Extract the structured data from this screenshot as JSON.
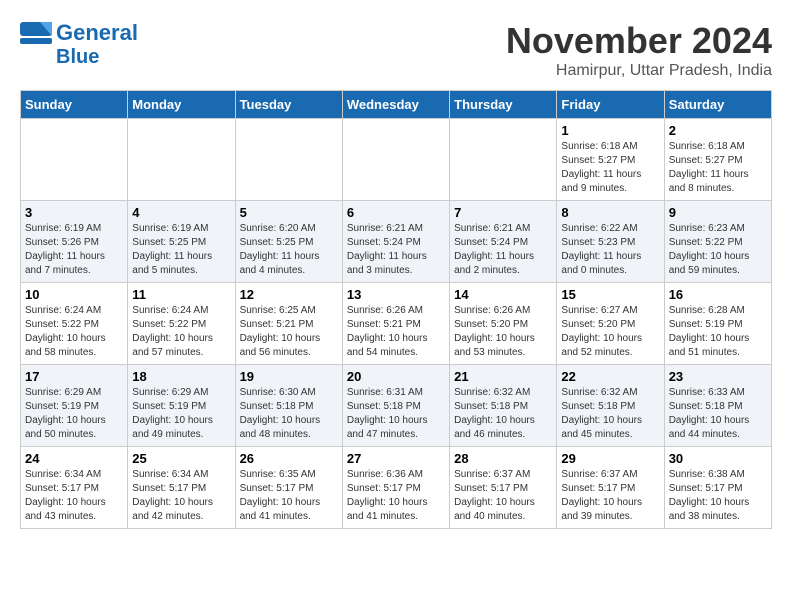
{
  "logo": {
    "line1": "General",
    "line2": "Blue"
  },
  "title": "November 2024",
  "location": "Hamirpur, Uttar Pradesh, India",
  "weekdays": [
    "Sunday",
    "Monday",
    "Tuesday",
    "Wednesday",
    "Thursday",
    "Friday",
    "Saturday"
  ],
  "weeks": [
    [
      {
        "day": "",
        "sunrise": "",
        "sunset": "",
        "daylight": ""
      },
      {
        "day": "",
        "sunrise": "",
        "sunset": "",
        "daylight": ""
      },
      {
        "day": "",
        "sunrise": "",
        "sunset": "",
        "daylight": ""
      },
      {
        "day": "",
        "sunrise": "",
        "sunset": "",
        "daylight": ""
      },
      {
        "day": "",
        "sunrise": "",
        "sunset": "",
        "daylight": ""
      },
      {
        "day": "1",
        "sunrise": "Sunrise: 6:18 AM",
        "sunset": "Sunset: 5:27 PM",
        "daylight": "Daylight: 11 hours and 9 minutes."
      },
      {
        "day": "2",
        "sunrise": "Sunrise: 6:18 AM",
        "sunset": "Sunset: 5:27 PM",
        "daylight": "Daylight: 11 hours and 8 minutes."
      }
    ],
    [
      {
        "day": "3",
        "sunrise": "Sunrise: 6:19 AM",
        "sunset": "Sunset: 5:26 PM",
        "daylight": "Daylight: 11 hours and 7 minutes."
      },
      {
        "day": "4",
        "sunrise": "Sunrise: 6:19 AM",
        "sunset": "Sunset: 5:25 PM",
        "daylight": "Daylight: 11 hours and 5 minutes."
      },
      {
        "day": "5",
        "sunrise": "Sunrise: 6:20 AM",
        "sunset": "Sunset: 5:25 PM",
        "daylight": "Daylight: 11 hours and 4 minutes."
      },
      {
        "day": "6",
        "sunrise": "Sunrise: 6:21 AM",
        "sunset": "Sunset: 5:24 PM",
        "daylight": "Daylight: 11 hours and 3 minutes."
      },
      {
        "day": "7",
        "sunrise": "Sunrise: 6:21 AM",
        "sunset": "Sunset: 5:24 PM",
        "daylight": "Daylight: 11 hours and 2 minutes."
      },
      {
        "day": "8",
        "sunrise": "Sunrise: 6:22 AM",
        "sunset": "Sunset: 5:23 PM",
        "daylight": "Daylight: 11 hours and 0 minutes."
      },
      {
        "day": "9",
        "sunrise": "Sunrise: 6:23 AM",
        "sunset": "Sunset: 5:22 PM",
        "daylight": "Daylight: 10 hours and 59 minutes."
      }
    ],
    [
      {
        "day": "10",
        "sunrise": "Sunrise: 6:24 AM",
        "sunset": "Sunset: 5:22 PM",
        "daylight": "Daylight: 10 hours and 58 minutes."
      },
      {
        "day": "11",
        "sunrise": "Sunrise: 6:24 AM",
        "sunset": "Sunset: 5:22 PM",
        "daylight": "Daylight: 10 hours and 57 minutes."
      },
      {
        "day": "12",
        "sunrise": "Sunrise: 6:25 AM",
        "sunset": "Sunset: 5:21 PM",
        "daylight": "Daylight: 10 hours and 56 minutes."
      },
      {
        "day": "13",
        "sunrise": "Sunrise: 6:26 AM",
        "sunset": "Sunset: 5:21 PM",
        "daylight": "Daylight: 10 hours and 54 minutes."
      },
      {
        "day": "14",
        "sunrise": "Sunrise: 6:26 AM",
        "sunset": "Sunset: 5:20 PM",
        "daylight": "Daylight: 10 hours and 53 minutes."
      },
      {
        "day": "15",
        "sunrise": "Sunrise: 6:27 AM",
        "sunset": "Sunset: 5:20 PM",
        "daylight": "Daylight: 10 hours and 52 minutes."
      },
      {
        "day": "16",
        "sunrise": "Sunrise: 6:28 AM",
        "sunset": "Sunset: 5:19 PM",
        "daylight": "Daylight: 10 hours and 51 minutes."
      }
    ],
    [
      {
        "day": "17",
        "sunrise": "Sunrise: 6:29 AM",
        "sunset": "Sunset: 5:19 PM",
        "daylight": "Daylight: 10 hours and 50 minutes."
      },
      {
        "day": "18",
        "sunrise": "Sunrise: 6:29 AM",
        "sunset": "Sunset: 5:19 PM",
        "daylight": "Daylight: 10 hours and 49 minutes."
      },
      {
        "day": "19",
        "sunrise": "Sunrise: 6:30 AM",
        "sunset": "Sunset: 5:18 PM",
        "daylight": "Daylight: 10 hours and 48 minutes."
      },
      {
        "day": "20",
        "sunrise": "Sunrise: 6:31 AM",
        "sunset": "Sunset: 5:18 PM",
        "daylight": "Daylight: 10 hours and 47 minutes."
      },
      {
        "day": "21",
        "sunrise": "Sunrise: 6:32 AM",
        "sunset": "Sunset: 5:18 PM",
        "daylight": "Daylight: 10 hours and 46 minutes."
      },
      {
        "day": "22",
        "sunrise": "Sunrise: 6:32 AM",
        "sunset": "Sunset: 5:18 PM",
        "daylight": "Daylight: 10 hours and 45 minutes."
      },
      {
        "day": "23",
        "sunrise": "Sunrise: 6:33 AM",
        "sunset": "Sunset: 5:18 PM",
        "daylight": "Daylight: 10 hours and 44 minutes."
      }
    ],
    [
      {
        "day": "24",
        "sunrise": "Sunrise: 6:34 AM",
        "sunset": "Sunset: 5:17 PM",
        "daylight": "Daylight: 10 hours and 43 minutes."
      },
      {
        "day": "25",
        "sunrise": "Sunrise: 6:34 AM",
        "sunset": "Sunset: 5:17 PM",
        "daylight": "Daylight: 10 hours and 42 minutes."
      },
      {
        "day": "26",
        "sunrise": "Sunrise: 6:35 AM",
        "sunset": "Sunset: 5:17 PM",
        "daylight": "Daylight: 10 hours and 41 minutes."
      },
      {
        "day": "27",
        "sunrise": "Sunrise: 6:36 AM",
        "sunset": "Sunset: 5:17 PM",
        "daylight": "Daylight: 10 hours and 41 minutes."
      },
      {
        "day": "28",
        "sunrise": "Sunrise: 6:37 AM",
        "sunset": "Sunset: 5:17 PM",
        "daylight": "Daylight: 10 hours and 40 minutes."
      },
      {
        "day": "29",
        "sunrise": "Sunrise: 6:37 AM",
        "sunset": "Sunset: 5:17 PM",
        "daylight": "Daylight: 10 hours and 39 minutes."
      },
      {
        "day": "30",
        "sunrise": "Sunrise: 6:38 AM",
        "sunset": "Sunset: 5:17 PM",
        "daylight": "Daylight: 10 hours and 38 minutes."
      }
    ]
  ]
}
